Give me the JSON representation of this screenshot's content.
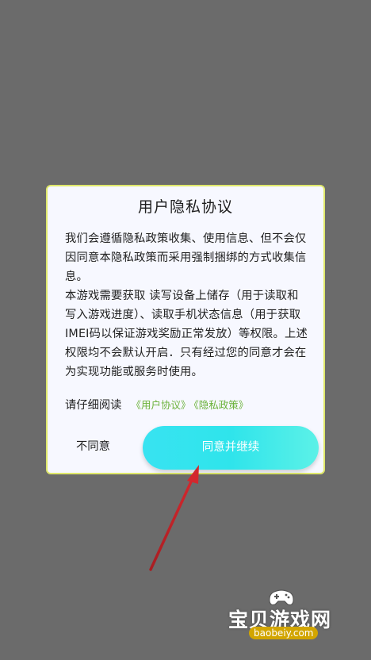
{
  "dialog": {
    "title": "用户隐私协议",
    "paragraph1": "我们会遵循隐私政策收集、使用信息、但不会仅因同意本隐私政策而采用强制捆绑的方式收集信息。",
    "paragraph2": "本游戏需要获取 读写设备上储存（用于读取和写入游戏进度）、读取手机状态信息（用于获取IMEI码以保证游戏奖励正常发放）等权限。上述权限均不会默认开启．只有经过您的同意才会在为实现功能或服务时使用。",
    "read_prompt": "请仔细阅读",
    "link_user_agreement": "《用户协议》",
    "link_privacy_policy": "《隐私政策》",
    "disagree_label": "不同意",
    "agree_label": "同意并继续"
  },
  "watermark": {
    "title": "宝贝游戏网",
    "url": "baobeiy.com"
  },
  "colors": {
    "accent": "#38e3f1",
    "link": "#6bb23a",
    "overlay": "#6b6b6b",
    "annotation_arrow": "#c8252b"
  }
}
